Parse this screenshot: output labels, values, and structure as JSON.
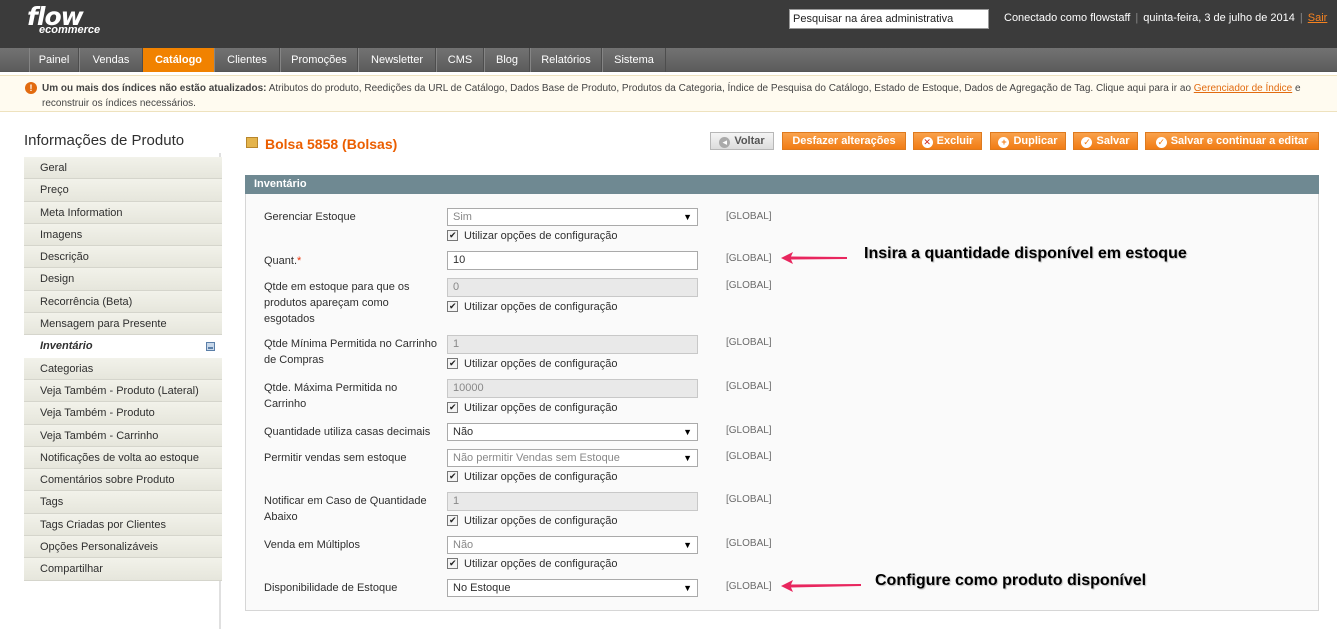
{
  "header": {
    "logo_top": "flow",
    "logo_bottom": "ecommerce",
    "search_placeholder": "Pesquisar na área administrativa",
    "connected": "Conectado como flowstaff",
    "date": "quinta-feira, 3 de julho de 2014",
    "logout": "Sair"
  },
  "nav": [
    {
      "label": "Painel",
      "active": false
    },
    {
      "label": "Vendas",
      "active": false
    },
    {
      "label": "Catálogo",
      "active": true
    },
    {
      "label": "Clientes",
      "active": false
    },
    {
      "label": "Promoções",
      "active": false
    },
    {
      "label": "Newsletter",
      "active": false
    },
    {
      "label": "CMS",
      "active": false
    },
    {
      "label": "Blog",
      "active": false
    },
    {
      "label": "Relatórios",
      "active": false
    },
    {
      "label": "Sistema",
      "active": false
    }
  ],
  "notice": {
    "icon": "!",
    "bold": "Um ou mais dos índices não estão atualizados:",
    "text": " Atributos do produto, Reedições da URL de Catálogo, Dados Base de Produto, Produtos da Categoria, Índice de Pesquisa do Catálogo, Estado de Estoque, Dados de Agregação de Tag. Clique aqui para ir ao ",
    "link": "Gerenciador de Índice",
    "tail": " e reconstruir os índices necessários."
  },
  "sidebar": {
    "title": "Informações de Produto",
    "items": [
      {
        "label": "Geral"
      },
      {
        "label": "Preço"
      },
      {
        "label": "Meta Information"
      },
      {
        "label": "Imagens"
      },
      {
        "label": "Descrição"
      },
      {
        "label": "Design"
      },
      {
        "label": "Recorrência (Beta)"
      },
      {
        "label": "Mensagem para Presente"
      },
      {
        "label": "Inventário"
      },
      {
        "label": "Categorias"
      },
      {
        "label": "Veja Também - Produto (Lateral)"
      },
      {
        "label": "Veja Também - Produto"
      },
      {
        "label": "Veja Também - Carrinho"
      },
      {
        "label": "Notificações de volta ao estoque"
      },
      {
        "label": "Comentários sobre Produto"
      },
      {
        "label": "Tags"
      },
      {
        "label": "Tags Criadas por Clientes"
      },
      {
        "label": "Opções Personalizáveis"
      },
      {
        "label": "Compartilhar"
      }
    ]
  },
  "page": {
    "title": "Bolsa 5858 (Bolsas)",
    "buttons": {
      "back": "Voltar",
      "reset": "Desfazer alterações",
      "delete": "Excluir",
      "duplicate": "Duplicar",
      "save": "Salvar",
      "save_continue": "Salvar e continuar a editar"
    }
  },
  "section": {
    "title": "Inventário",
    "use_config": "Utilizar opções de configuração",
    "scope": "[GLOBAL]",
    "fields": {
      "manage_stock": {
        "label": "Gerenciar Estoque",
        "value": "Sim"
      },
      "qty": {
        "label": "Quant.",
        "required": "*",
        "value": "10"
      },
      "min_qty": {
        "label": "Qtde em estoque para que os produtos apareçam como esgotados",
        "value": "0"
      },
      "min_sale_qty": {
        "label": "Qtde Mínima Permitida no Carrinho de Compras",
        "value": "1"
      },
      "max_sale_qty": {
        "label": "Qtde. Máxima Permitida no Carrinho",
        "value": "10000"
      },
      "decimals": {
        "label": "Quantidade utiliza casas decimais",
        "value": "Não"
      },
      "backorders": {
        "label": "Permitir vendas sem estoque",
        "value": "Não permitir Vendas sem Estoque"
      },
      "notify_qty": {
        "label": "Notificar em Caso de Quantidade Abaixo",
        "value": "1"
      },
      "qty_increments": {
        "label": "Venda em Múltiplos",
        "value": "Não"
      },
      "stock_status": {
        "label": "Disponibilidade de Estoque",
        "value": "No Estoque"
      }
    }
  },
  "annotations": {
    "qty_note": "Insira a quantidade disponível em estoque",
    "status_note": "Configure como produto disponível",
    "arrow_color": "#e8265e"
  }
}
